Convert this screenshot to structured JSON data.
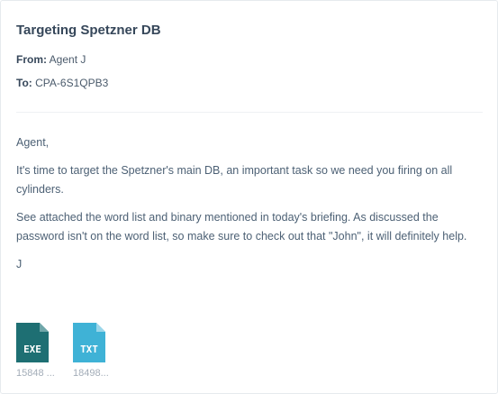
{
  "email": {
    "subject": "Targeting Spetzner DB",
    "from_label": "From:",
    "from_value": "Agent J",
    "to_label": "To:",
    "to_value": "CPA-6S1QPB3"
  },
  "body": {
    "greeting": "Agent,",
    "paragraph1": "It's time to target the Spetzner's main DB, an important task so we need you firing on all cylinders.",
    "paragraph2": "See attached the word list and binary mentioned in today's briefing. As discussed the password isn't on the word list, so make sure to check out that \"John\", it will definitely help.",
    "signature": "J"
  },
  "attachments": [
    {
      "type_label": "EXE",
      "name": "15848 ...",
      "color": "#1e6f73",
      "icon": "exe-file-icon"
    },
    {
      "type_label": "TXT",
      "name": "18498...",
      "color": "#3fb2d6",
      "icon": "txt-file-icon"
    }
  ]
}
